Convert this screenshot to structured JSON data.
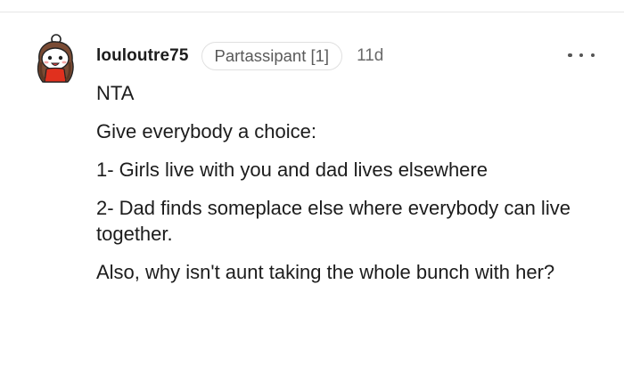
{
  "comment": {
    "username": "louloutre75",
    "flair": "Partassipant [1]",
    "timestamp": "11d",
    "more_menu_icon": "ellipsis-icon",
    "avatar_icon": "snoo-avatar-icon",
    "paragraphs": [
      "NTA",
      "Give everybody a choice:",
      "1- Girls live with you and dad lives elsewhere",
      "2- Dad finds someplace else where everybody can live together.",
      "Also, why isn't aunt taking the whole bunch with her?"
    ]
  },
  "colors": {
    "text": "#1c1c1c",
    "muted": "#6a6a6a",
    "flair_border": "#e0e0e0",
    "avatar_shirt": "#e0301e"
  }
}
